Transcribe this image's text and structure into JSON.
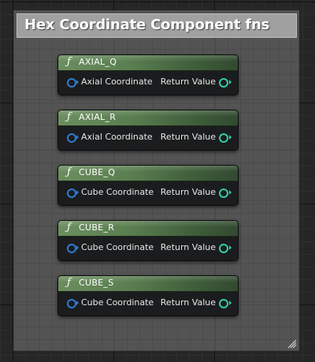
{
  "comment": {
    "title": "Hex Coordinate Component fns"
  },
  "nodes": [
    {
      "title": "AXIAL_Q",
      "input_label": "Axial Coordinate",
      "output_label": "Return Value"
    },
    {
      "title": "AXIAL_R",
      "input_label": "Axial Coordinate",
      "output_label": "Return Value"
    },
    {
      "title": "CUBE_Q",
      "input_label": "Cube Coordinate",
      "output_label": "Return Value"
    },
    {
      "title": "CUBE_R",
      "input_label": "Cube Coordinate",
      "output_label": "Return Value"
    },
    {
      "title": "CUBE_S",
      "input_label": "Cube Coordinate",
      "output_label": "Return Value"
    }
  ],
  "function_glyph": "ƒ",
  "colors": {
    "node_header": "#5a7e50",
    "input_pin": "#2f7bd0",
    "output_pin": "#2fcfa8"
  },
  "icons": {
    "function": "function-icon",
    "input_pin": "struct-pin-icon",
    "output_pin": "output-pin-icon",
    "resize": "resize-grip-icon"
  }
}
